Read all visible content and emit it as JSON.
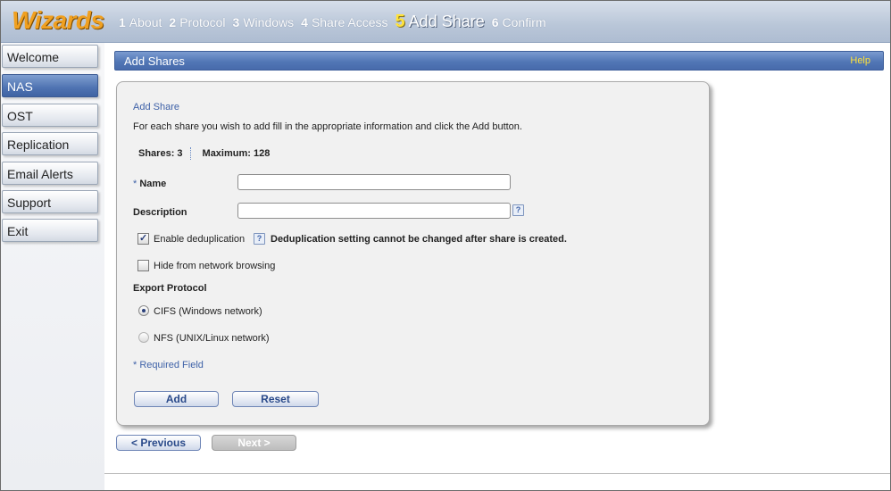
{
  "header": {
    "brand": "Wizards",
    "steps": [
      {
        "num": "1",
        "label": "About"
      },
      {
        "num": "2",
        "label": "Protocol"
      },
      {
        "num": "3",
        "label": "Windows"
      },
      {
        "num": "4",
        "label": "Share Access"
      },
      {
        "num": "5",
        "label": "Add Share",
        "active": true
      },
      {
        "num": "6",
        "label": "Confirm"
      }
    ]
  },
  "sidebar": {
    "items": [
      {
        "label": "Welcome"
      },
      {
        "label": "NAS",
        "active": true
      },
      {
        "label": "OST"
      },
      {
        "label": "Replication"
      },
      {
        "label": "Email Alerts"
      },
      {
        "label": "Support"
      },
      {
        "label": "Exit"
      }
    ]
  },
  "titlebar": {
    "title": "Add Shares",
    "help": "Help"
  },
  "form": {
    "section_title": "Add Share",
    "instructions": "For each share you wish to add fill in the appropriate information and click the Add button.",
    "shares_label": "Shares: 3",
    "maximum_label": "Maximum: 128",
    "name_star": "*",
    "name_label": "Name",
    "name_value": "",
    "description_label": "Description",
    "description_value": "",
    "help_glyph": "?",
    "dedup_label": "Enable deduplication",
    "dedup_checked": true,
    "dedup_warning": "Deduplication setting cannot be changed after share is created.",
    "hide_label": "Hide from network browsing",
    "hide_checked": false,
    "export_protocol_label": "Export Protocol",
    "protocol_options": [
      {
        "label": "CIFS (Windows network)",
        "selected": true
      },
      {
        "label": "NFS (UNIX/Linux network)",
        "selected": false
      }
    ],
    "required_note": "* Required Field",
    "add_button": "Add",
    "reset_button": "Reset"
  },
  "nav": {
    "previous": "< Previous",
    "next": "Next >"
  },
  "colors": {
    "accent": "#4f73b2",
    "brand": "#f0a020",
    "active_step": "#ffe23a",
    "link": "#3f62a8"
  }
}
